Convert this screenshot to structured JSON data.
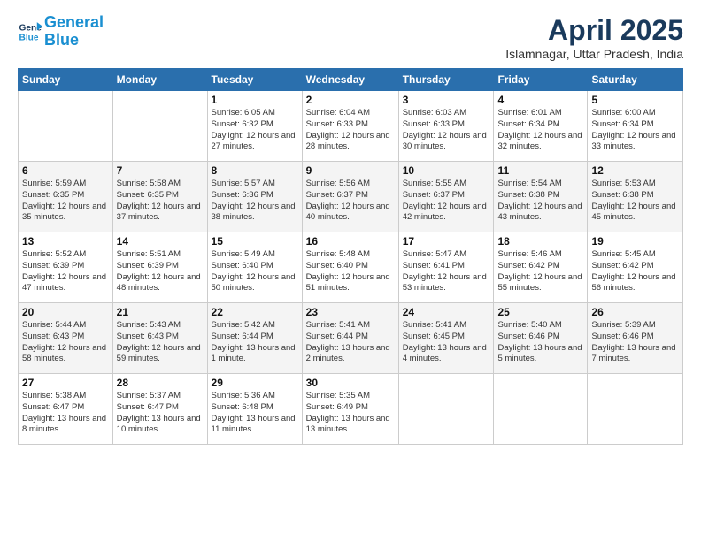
{
  "header": {
    "logo_line1": "General",
    "logo_line2": "Blue",
    "month_year": "April 2025",
    "location": "Islamnagar, Uttar Pradesh, India"
  },
  "weekdays": [
    "Sunday",
    "Monday",
    "Tuesday",
    "Wednesday",
    "Thursday",
    "Friday",
    "Saturday"
  ],
  "weeks": [
    [
      {
        "day": "",
        "info": ""
      },
      {
        "day": "",
        "info": ""
      },
      {
        "day": "1",
        "info": "Sunrise: 6:05 AM\nSunset: 6:32 PM\nDaylight: 12 hours and 27 minutes."
      },
      {
        "day": "2",
        "info": "Sunrise: 6:04 AM\nSunset: 6:33 PM\nDaylight: 12 hours and 28 minutes."
      },
      {
        "day": "3",
        "info": "Sunrise: 6:03 AM\nSunset: 6:33 PM\nDaylight: 12 hours and 30 minutes."
      },
      {
        "day": "4",
        "info": "Sunrise: 6:01 AM\nSunset: 6:34 PM\nDaylight: 12 hours and 32 minutes."
      },
      {
        "day": "5",
        "info": "Sunrise: 6:00 AM\nSunset: 6:34 PM\nDaylight: 12 hours and 33 minutes."
      }
    ],
    [
      {
        "day": "6",
        "info": "Sunrise: 5:59 AM\nSunset: 6:35 PM\nDaylight: 12 hours and 35 minutes."
      },
      {
        "day": "7",
        "info": "Sunrise: 5:58 AM\nSunset: 6:35 PM\nDaylight: 12 hours and 37 minutes."
      },
      {
        "day": "8",
        "info": "Sunrise: 5:57 AM\nSunset: 6:36 PM\nDaylight: 12 hours and 38 minutes."
      },
      {
        "day": "9",
        "info": "Sunrise: 5:56 AM\nSunset: 6:37 PM\nDaylight: 12 hours and 40 minutes."
      },
      {
        "day": "10",
        "info": "Sunrise: 5:55 AM\nSunset: 6:37 PM\nDaylight: 12 hours and 42 minutes."
      },
      {
        "day": "11",
        "info": "Sunrise: 5:54 AM\nSunset: 6:38 PM\nDaylight: 12 hours and 43 minutes."
      },
      {
        "day": "12",
        "info": "Sunrise: 5:53 AM\nSunset: 6:38 PM\nDaylight: 12 hours and 45 minutes."
      }
    ],
    [
      {
        "day": "13",
        "info": "Sunrise: 5:52 AM\nSunset: 6:39 PM\nDaylight: 12 hours and 47 minutes."
      },
      {
        "day": "14",
        "info": "Sunrise: 5:51 AM\nSunset: 6:39 PM\nDaylight: 12 hours and 48 minutes."
      },
      {
        "day": "15",
        "info": "Sunrise: 5:49 AM\nSunset: 6:40 PM\nDaylight: 12 hours and 50 minutes."
      },
      {
        "day": "16",
        "info": "Sunrise: 5:48 AM\nSunset: 6:40 PM\nDaylight: 12 hours and 51 minutes."
      },
      {
        "day": "17",
        "info": "Sunrise: 5:47 AM\nSunset: 6:41 PM\nDaylight: 12 hours and 53 minutes."
      },
      {
        "day": "18",
        "info": "Sunrise: 5:46 AM\nSunset: 6:42 PM\nDaylight: 12 hours and 55 minutes."
      },
      {
        "day": "19",
        "info": "Sunrise: 5:45 AM\nSunset: 6:42 PM\nDaylight: 12 hours and 56 minutes."
      }
    ],
    [
      {
        "day": "20",
        "info": "Sunrise: 5:44 AM\nSunset: 6:43 PM\nDaylight: 12 hours and 58 minutes."
      },
      {
        "day": "21",
        "info": "Sunrise: 5:43 AM\nSunset: 6:43 PM\nDaylight: 12 hours and 59 minutes."
      },
      {
        "day": "22",
        "info": "Sunrise: 5:42 AM\nSunset: 6:44 PM\nDaylight: 13 hours and 1 minute."
      },
      {
        "day": "23",
        "info": "Sunrise: 5:41 AM\nSunset: 6:44 PM\nDaylight: 13 hours and 2 minutes."
      },
      {
        "day": "24",
        "info": "Sunrise: 5:41 AM\nSunset: 6:45 PM\nDaylight: 13 hours and 4 minutes."
      },
      {
        "day": "25",
        "info": "Sunrise: 5:40 AM\nSunset: 6:46 PM\nDaylight: 13 hours and 5 minutes."
      },
      {
        "day": "26",
        "info": "Sunrise: 5:39 AM\nSunset: 6:46 PM\nDaylight: 13 hours and 7 minutes."
      }
    ],
    [
      {
        "day": "27",
        "info": "Sunrise: 5:38 AM\nSunset: 6:47 PM\nDaylight: 13 hours and 8 minutes."
      },
      {
        "day": "28",
        "info": "Sunrise: 5:37 AM\nSunset: 6:47 PM\nDaylight: 13 hours and 10 minutes."
      },
      {
        "day": "29",
        "info": "Sunrise: 5:36 AM\nSunset: 6:48 PM\nDaylight: 13 hours and 11 minutes."
      },
      {
        "day": "30",
        "info": "Sunrise: 5:35 AM\nSunset: 6:49 PM\nDaylight: 13 hours and 13 minutes."
      },
      {
        "day": "",
        "info": ""
      },
      {
        "day": "",
        "info": ""
      },
      {
        "day": "",
        "info": ""
      }
    ]
  ]
}
